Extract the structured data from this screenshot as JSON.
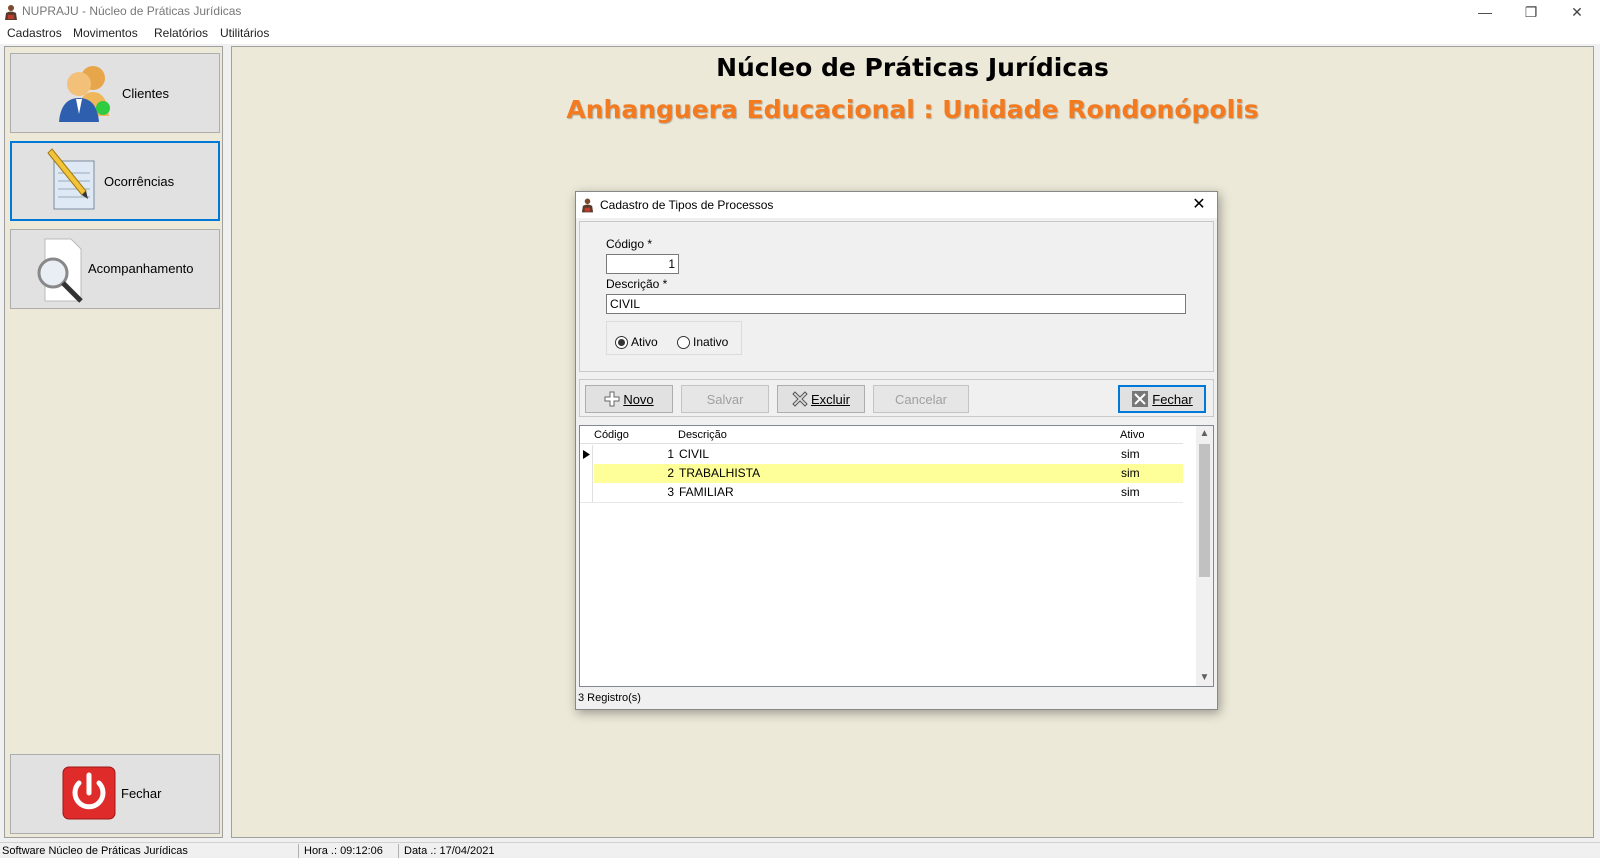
{
  "window": {
    "title": "NUPRAJU - Núcleo de Práticas Jurídicas",
    "controls": {
      "minimize": "—",
      "restore": "❐",
      "close": "✕"
    }
  },
  "menu": [
    "Cadastros",
    "Movimentos",
    "Relatórios",
    "Utilitários"
  ],
  "sidebar": {
    "items": [
      {
        "label": "Clientes",
        "icon": "clients-icon"
      },
      {
        "label": "Ocorrências",
        "icon": "notepad-icon"
      },
      {
        "label": "Acompanhamento",
        "icon": "magnifier-icon"
      }
    ],
    "close_label": "Fechar"
  },
  "main": {
    "heading": "Núcleo de Práticas Jurídicas",
    "subheading": "Anhanguera Educacional : Unidade Rondonópolis"
  },
  "dialog": {
    "title": "Cadastro de Tipos de Processos",
    "close_glyph": "✕",
    "form": {
      "codigo_label": "Código *",
      "codigo_value": "1",
      "descricao_label": "Descrição *",
      "descricao_value": "CIVIL",
      "radio_ativo": "Ativo",
      "radio_inativo": "Inativo",
      "selected_status": "Ativo"
    },
    "toolbar": {
      "novo": "Novo",
      "salvar": "Salvar",
      "excluir": "Excluir",
      "cancelar": "Cancelar",
      "fechar": "Fechar"
    },
    "grid": {
      "columns": [
        "Código",
        "Descrição",
        "Ativo"
      ],
      "rows": [
        {
          "codigo": "1",
          "descricao": "CIVIL",
          "ativo": "sim"
        },
        {
          "codigo": "2",
          "descricao": "TRABALHISTA",
          "ativo": "sim"
        },
        {
          "codigo": "3",
          "descricao": "FAMILIAR",
          "ativo": "sim"
        }
      ]
    },
    "record_count": "3 Registro(s)"
  },
  "statusbar": {
    "software": "Software Núcleo de Práticas Jurídicas",
    "hora": "Hora .: 09:12:06",
    "data": "Data .: 17/04/2021"
  },
  "colors": {
    "accent": "#0078d7",
    "subheading": "#f47a1f",
    "selected_row": "#ffff99",
    "panel_bg": "#ece9d8"
  }
}
